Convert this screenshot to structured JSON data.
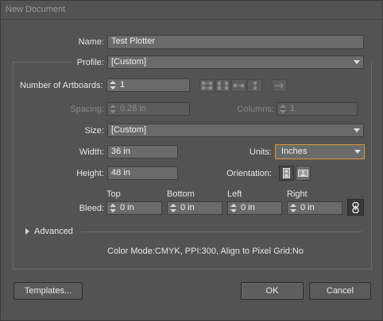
{
  "window": {
    "title": "New Document"
  },
  "name": {
    "label": "Name:",
    "value": "Test Plotter"
  },
  "profile": {
    "label": "Profile:",
    "value": "[Custom]"
  },
  "artboards": {
    "label": "Number of Artboards:",
    "value": "1",
    "arrange_icons": [
      "grid-by-row-icon",
      "grid-by-column-icon",
      "arrange-by-row-icon",
      "arrange-by-column-icon",
      "right-to-left-icon"
    ]
  },
  "spacing": {
    "label": "Spacing:",
    "value": "0.28 in"
  },
  "columns": {
    "label": "Columns:",
    "value": "1"
  },
  "size": {
    "label": "Size:",
    "value": "[Custom]"
  },
  "width": {
    "label": "Width:",
    "value": "36 in"
  },
  "units": {
    "label": "Units:",
    "value": "Inches"
  },
  "height": {
    "label": "Height:",
    "value": "48 in"
  },
  "orientation": {
    "label": "Orientation:",
    "options": [
      "portrait-icon",
      "landscape-icon"
    ],
    "selected": "portrait"
  },
  "bleed": {
    "label": "Bleed:",
    "top": {
      "label": "Top",
      "value": "0 in"
    },
    "bottom": {
      "label": "Bottom",
      "value": "0 in"
    },
    "left": {
      "label": "Left",
      "value": "0 in"
    },
    "right": {
      "label": "Right",
      "value": "0 in"
    },
    "link_icon": "chain-link-icon"
  },
  "advanced": {
    "label": "Advanced"
  },
  "summary": "Color Mode:CMYK, PPI:300, Align to Pixel Grid:No",
  "buttons": {
    "templates": "Templates...",
    "ok": "OK",
    "cancel": "Cancel"
  },
  "colors": {
    "background": "#535353",
    "field": "#6a6a6a",
    "focus_border": "#d89a3a"
  }
}
